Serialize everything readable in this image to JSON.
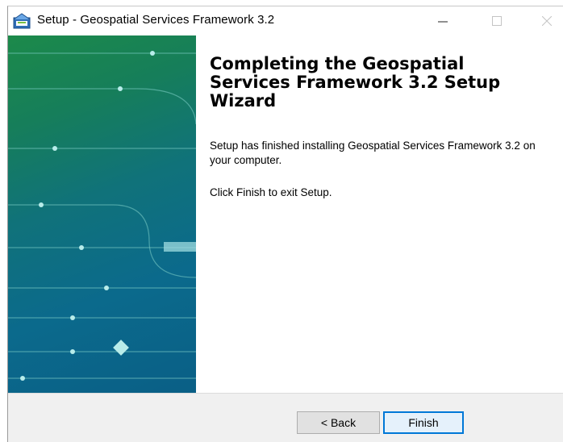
{
  "window": {
    "title": "Setup - Geospatial Services Framework 3.2",
    "app_icon": "installer-icon",
    "controls": {
      "minimize_icon": "minimize-icon",
      "maximize_icon": "maximize-icon",
      "close_icon": "close-icon"
    }
  },
  "sidebar": {
    "image": "wizard-graphic",
    "colors": {
      "top": "#1c8a4a",
      "bottom": "#0a5f86"
    }
  },
  "main": {
    "heading": "Completing the Geospatial Services Framework 3.2 Setup Wizard",
    "message": "Setup has finished installing Geospatial Services Framework 3.2 on your computer.",
    "instruction": "Click Finish to exit Setup."
  },
  "footer": {
    "back_label": "< Back",
    "finish_label": "Finish"
  },
  "colors": {
    "accent": "#0078d7",
    "footer_bg": "#f0f0f0"
  }
}
